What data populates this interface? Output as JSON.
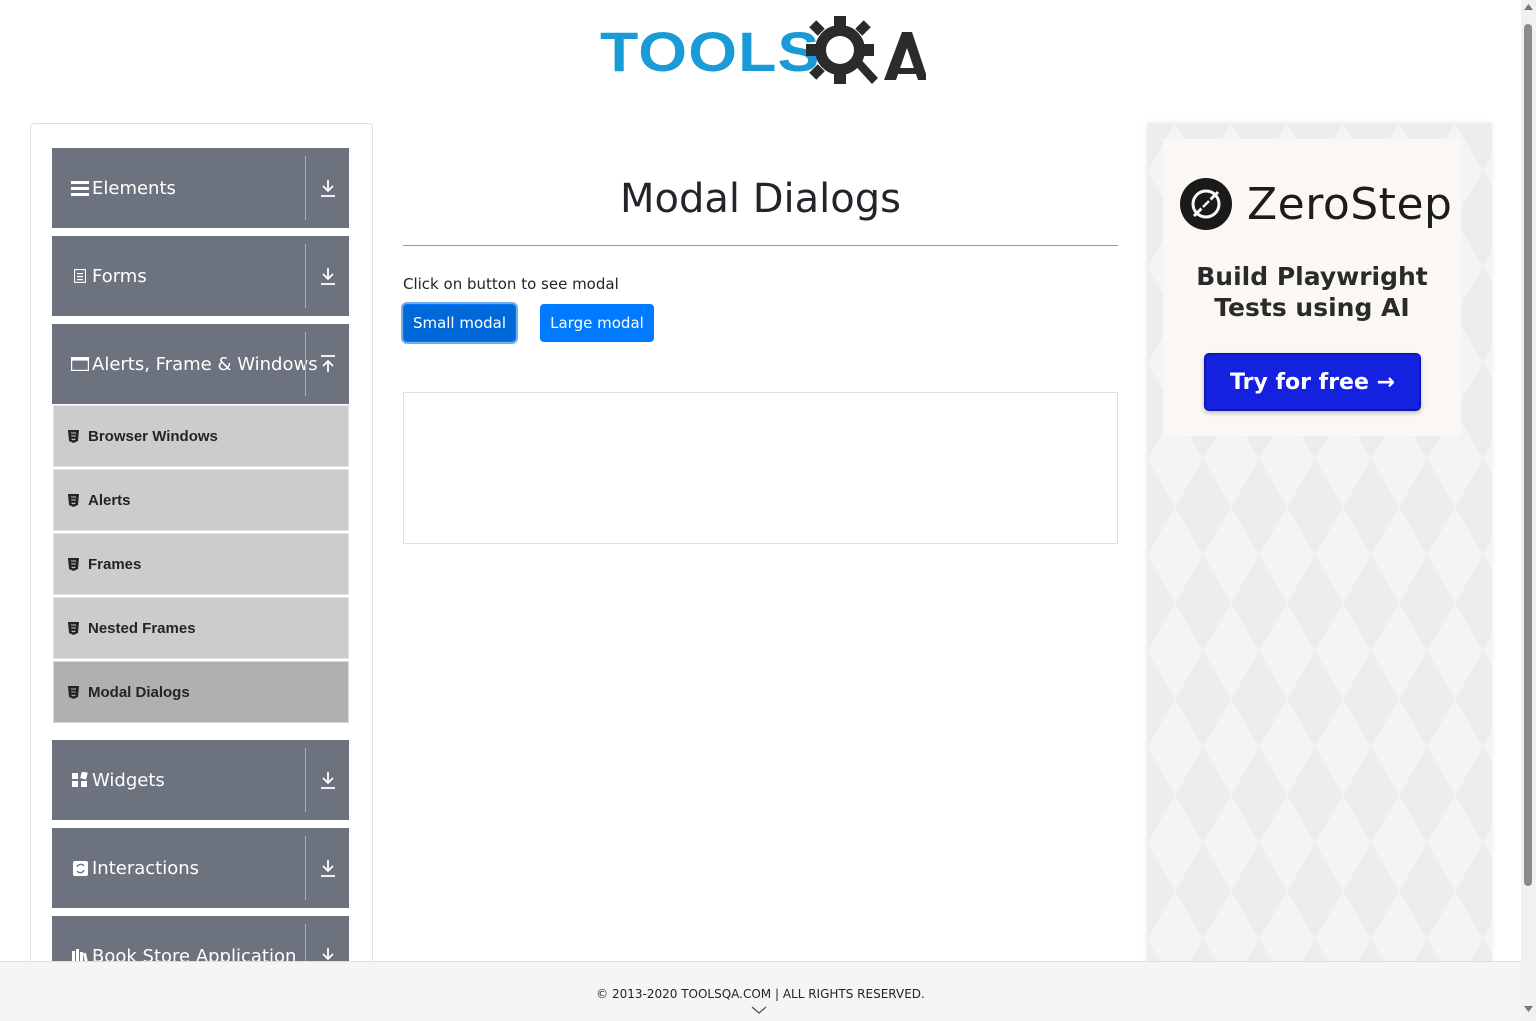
{
  "header": {
    "logo_text": "TOOLSQA"
  },
  "sidebar": {
    "groups": [
      {
        "label": "Elements",
        "icon": "hamburger-icon",
        "state": "collapsed"
      },
      {
        "label": "Forms",
        "icon": "document-icon",
        "state": "collapsed"
      },
      {
        "label": "Alerts, Frame & Windows",
        "icon": "window-icon",
        "state": "expanded"
      },
      {
        "label": "Widgets",
        "icon": "grid-icon",
        "state": "collapsed"
      },
      {
        "label": "Interactions",
        "icon": "interaction-icon",
        "state": "collapsed"
      },
      {
        "label": "Book Store Application",
        "icon": "books-icon",
        "state": "collapsed"
      }
    ],
    "items": [
      {
        "label": "Browser Windows"
      },
      {
        "label": "Alerts"
      },
      {
        "label": "Frames"
      },
      {
        "label": "Nested Frames"
      },
      {
        "label": "Modal Dialogs",
        "active": true
      }
    ]
  },
  "main": {
    "title": "Modal Dialogs",
    "instruction": "Click on button to see modal",
    "small_modal_label": "Small modal",
    "large_modal_label": "Large modal"
  },
  "ad": {
    "brand": "ZeroStep",
    "line1": "Build Playwright",
    "line2": "Tests using AI",
    "cta": "Try for free →"
  },
  "footer": {
    "text": "© 2013-2020 TOOLSQA.COM | ALL RIGHTS RESERVED."
  },
  "colors": {
    "primary": "#007bff",
    "sidebar_header": "#6c737e",
    "sidebar_item": "#cccccc",
    "ad_button": "#1422e0",
    "logo_blue": "#1a9ad6"
  }
}
